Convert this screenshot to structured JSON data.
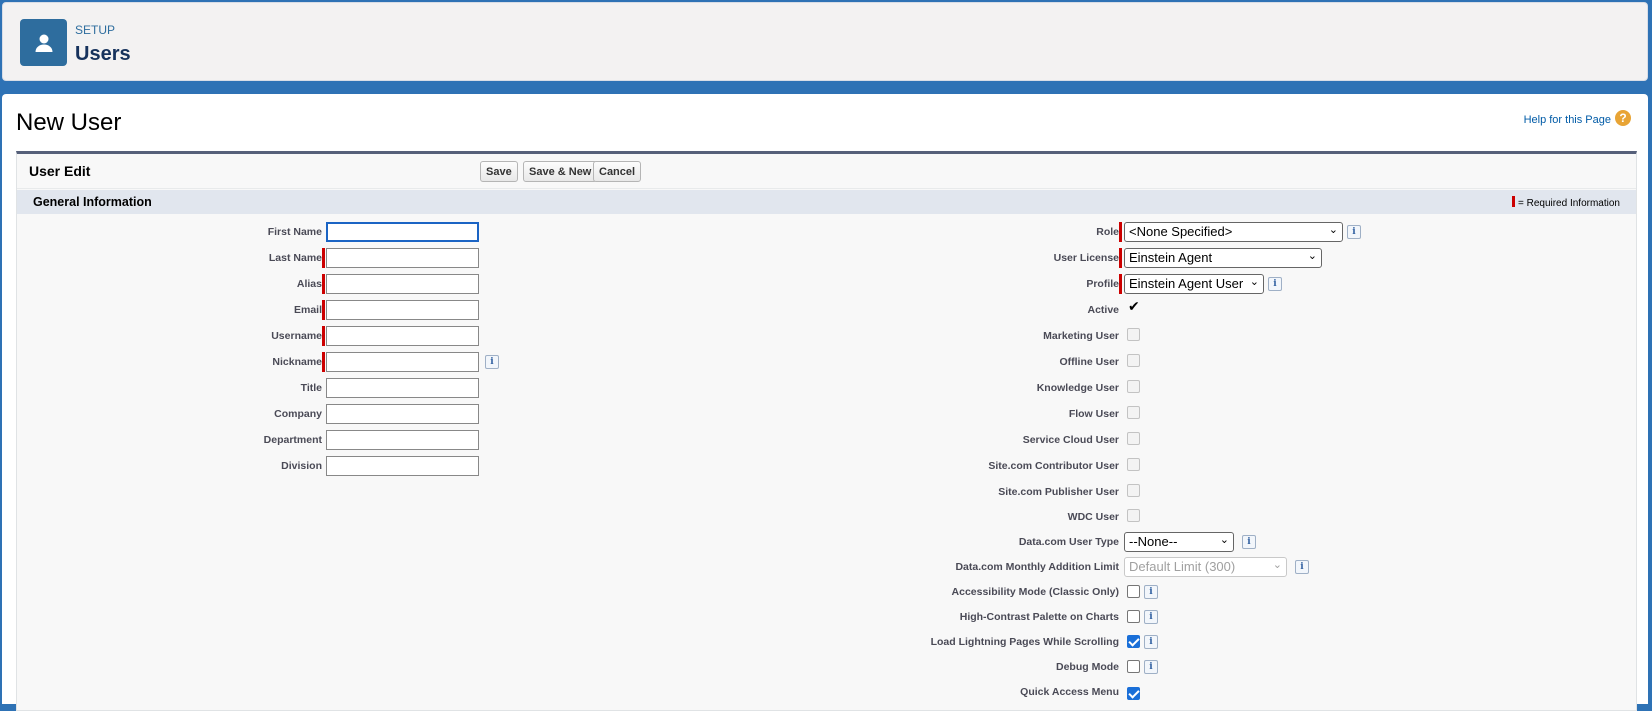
{
  "header": {
    "crumb": "SETUP",
    "title": "Users",
    "icon": "user-icon"
  },
  "page": {
    "title": "New User",
    "help_link": "Help for this Page",
    "help_icon": "?"
  },
  "edit": {
    "title": "User Edit",
    "buttons": {
      "save": "Save",
      "save_new": "Save & New",
      "cancel": "Cancel"
    }
  },
  "section": {
    "title": "General Information",
    "required_note": "= Required Information"
  },
  "left_fields": {
    "first_name": {
      "label": "First Name",
      "value": ""
    },
    "last_name": {
      "label": "Last Name",
      "value": ""
    },
    "alias": {
      "label": "Alias",
      "value": ""
    },
    "email": {
      "label": "Email",
      "value": ""
    },
    "username": {
      "label": "Username",
      "value": ""
    },
    "nickname": {
      "label": "Nickname",
      "value": ""
    },
    "title": {
      "label": "Title",
      "value": ""
    },
    "company": {
      "label": "Company",
      "value": ""
    },
    "department": {
      "label": "Department",
      "value": ""
    },
    "division": {
      "label": "Division",
      "value": ""
    }
  },
  "right_fields": {
    "role": {
      "label": "Role",
      "value": "<None Specified>"
    },
    "user_license": {
      "label": "User License",
      "value": "Einstein Agent"
    },
    "profile": {
      "label": "Profile",
      "value": "Einstein Agent User"
    },
    "active": {
      "label": "Active",
      "checked": true
    },
    "marketing_user": {
      "label": "Marketing User",
      "checked": false
    },
    "offline_user": {
      "label": "Offline User",
      "checked": false
    },
    "knowledge_user": {
      "label": "Knowledge User",
      "checked": false
    },
    "flow_user": {
      "label": "Flow User",
      "checked": false
    },
    "service_cloud_user": {
      "label": "Service Cloud User",
      "checked": false
    },
    "sitecom_contributor": {
      "label": "Site.com Contributor User",
      "checked": false
    },
    "sitecom_publisher": {
      "label": "Site.com Publisher User",
      "checked": false
    },
    "wdc_user": {
      "label": "WDC User",
      "checked": false
    },
    "datacom_user_type": {
      "label": "Data.com User Type",
      "value": "--None--"
    },
    "datacom_monthly_limit": {
      "label": "Data.com Monthly Addition Limit",
      "value": "Default Limit (300)"
    },
    "accessibility_mode": {
      "label": "Accessibility Mode (Classic Only)",
      "checked": false
    },
    "high_contrast": {
      "label": "High-Contrast Palette on Charts",
      "checked": false
    },
    "load_lightning": {
      "label": "Load Lightning Pages While Scrolling",
      "checked": true
    },
    "debug_mode": {
      "label": "Debug Mode",
      "checked": false
    },
    "quick_access": {
      "label": "Quick Access Menu",
      "checked": true
    }
  },
  "info_glyph": "i",
  "colors": {
    "brand": "#2e6d9e",
    "required": "#cc0000",
    "section_bg": "#e1e6ee",
    "link": "#015ba7"
  }
}
